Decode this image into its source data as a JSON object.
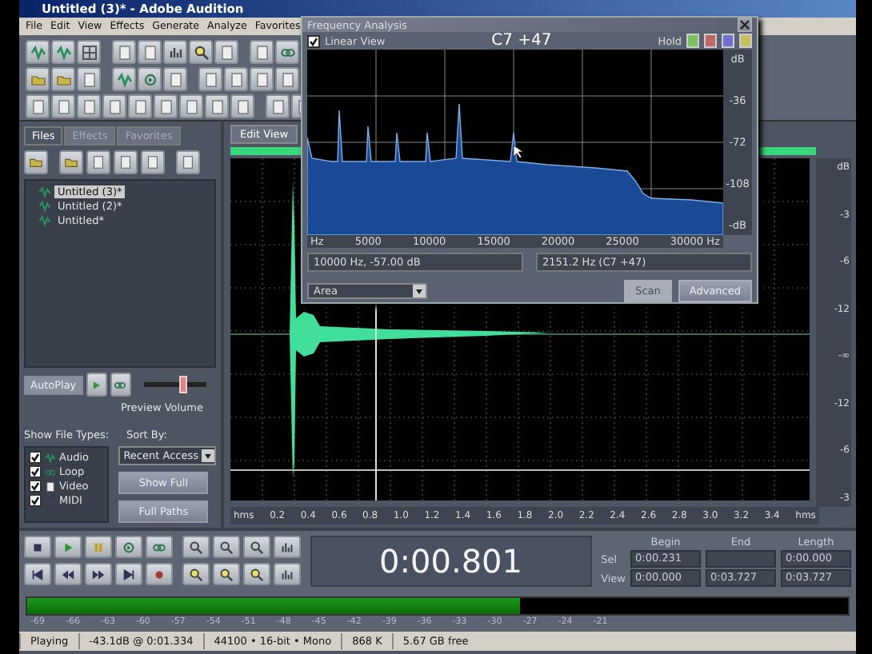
{
  "window": {
    "title": "Untitled (3)* - Adobe Audition"
  },
  "menu": [
    "File",
    "Edit",
    "View",
    "Effects",
    "Generate",
    "Analyze",
    "Favorites"
  ],
  "files_panel": {
    "tabs": [
      {
        "label": "Files",
        "selected": true
      },
      {
        "label": "Effects",
        "selected": false
      },
      {
        "label": "Favorites",
        "selected": false
      }
    ],
    "files": [
      {
        "name": "Untitled (3)*",
        "selected": true
      },
      {
        "name": "Untitled (2)*",
        "selected": false
      },
      {
        "name": "Untitled*",
        "selected": false
      }
    ],
    "autoplay": "AutoPlay",
    "preview_volume": {
      "label": "Preview Volume",
      "level": 0.62
    },
    "file_types_label": "Show File Types:",
    "file_types": [
      {
        "label": "Audio",
        "checked": true
      },
      {
        "label": "Loop",
        "checked": true
      },
      {
        "label": "Video",
        "checked": true
      },
      {
        "label": "MIDI",
        "checked": true
      }
    ],
    "sort_by": {
      "label": "Sort By:",
      "value": "Recent Access"
    },
    "buttons": [
      "Show Full",
      "Full Paths"
    ]
  },
  "editor": {
    "tab": "Edit View",
    "ruler": [
      "hms",
      "0.2",
      "0.4",
      "0.6",
      "0.8",
      "1.0",
      "1.2",
      "1.4",
      "1.6",
      "1.8",
      "2.0",
      "2.2",
      "2.4",
      "2.6",
      "2.8",
      "3.0",
      "3.2",
      "3.4",
      "hms"
    ],
    "db_scale": [
      "dB",
      "-3",
      "-6",
      "-12",
      "-∞",
      "-12",
      "-6",
      "-3"
    ]
  },
  "frequency_dialog": {
    "title": "Frequency Analysis",
    "linear_view": {
      "label": "Linear View",
      "checked": true
    },
    "note": "C7 +47",
    "hold": {
      "label": "Hold",
      "buttons": [
        {
          "color": "#78c060"
        },
        {
          "color": "#c06868"
        },
        {
          "color": "#7070d0"
        },
        {
          "color": "#c8c060"
        }
      ]
    },
    "y_labels": [
      "dB",
      "-36",
      "-72",
      "-108",
      "-dB"
    ],
    "x_labels": [
      "Hz",
      "5000",
      "10000",
      "15000",
      "20000",
      "25000",
      "30000 Hz"
    ],
    "readout_left": "10000 Hz, -57.00 dB",
    "readout_right": "2151.2 Hz (C7 +47)",
    "mode": "Area",
    "buttons": [
      {
        "label": "Scan",
        "disabled": true
      },
      {
        "label": "Advanced",
        "disabled": false
      }
    ]
  },
  "transport": {
    "time": "0:00.801",
    "columns": [
      "Begin",
      "End",
      "Length"
    ],
    "rows": [
      {
        "label": "Sel",
        "begin": "0:00.231",
        "length": "0:00.000"
      },
      {
        "label": "View",
        "begin": "0:00.000",
        "end": "0:03.727",
        "length": "0:03.727"
      }
    ]
  },
  "meter": {
    "level": 0.6,
    "scale": [
      "-69",
      "-66",
      "-63",
      "-60",
      "-57",
      "-54",
      "-51",
      "-48",
      "-45",
      "-42",
      "-39",
      "-36",
      "-33",
      "-30",
      "-27",
      "-24",
      "-21"
    ]
  },
  "status_bar": [
    "Playing",
    "-43.1dB @ 0:01.334",
    "44100 • 16-bit • Mono",
    "868 K",
    "5.67 GB free"
  ]
}
